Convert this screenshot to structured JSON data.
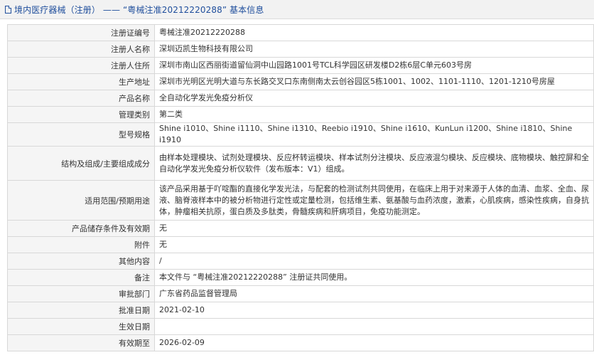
{
  "header": {
    "icon": "document-icon",
    "title": "境内医疗器械（注册） —— “粤械注准20212220288” 基本信息"
  },
  "rows": [
    {
      "label": "注册证编号",
      "value": "粤械注准20212220288"
    },
    {
      "label": "注册人名称",
      "value": "深圳迈凯生物科技有限公司"
    },
    {
      "label": "注册人住所",
      "value": "深圳市南山区西丽街道留仙洞中山园路1001号TCL科学园区研发楼D2栋6层C单元603号房"
    },
    {
      "label": "生产地址",
      "value": "深圳市光明区光明大道与东长路交叉口东南侧南太云创谷园区5栋1001、1002、1101-1110、1201-1210号房屋"
    },
    {
      "label": "产品名称",
      "value": "全自动化学发光免疫分析仪"
    },
    {
      "label": "管理类别",
      "value": "第二类"
    },
    {
      "label": "型号规格",
      "value": "Shine i1010、Shine i1110、Shine i1310、Reebio i1910、Shine i1610、KunLun i1200、Shine i1810、Shine i1910"
    },
    {
      "label": "结构及组成/主要组成成分",
      "value": "由样本处理模块、试剂处理模块、反应杯转运模块、样本试剂分注模块、反应液混匀模块、反应模块、底物模块、触控屏和全自动化学发光免疫分析仪软件（发布版本：V1）组成。"
    },
    {
      "label": "适用范围/预期用途",
      "value": "该产品采用基于吖啶酯的直接化学发光法，与配套的检测试剂共同使用，在临床上用于对来源于人体的血清、血浆、全血、尿液、脑脊液样本中的被分析物进行定性或定量检测，包括维生素、氨基酸与血药浓度，激素，心肌疾病，感染性疾病，自身抗体，肿瘤相关抗原，蛋白质及多肽类，骨髓疾病和肝病项目，免疫功能测定。"
    },
    {
      "label": "产品储存条件及有效期",
      "value": "无"
    },
    {
      "label": "附件",
      "value": "无"
    },
    {
      "label": "其他内容",
      "value": "/"
    },
    {
      "label": "备注",
      "value": "本文件与 “粤械注准20212220288” 注册证共同使用。"
    },
    {
      "label": "审批部门",
      "value": "广东省药品监督管理局"
    },
    {
      "label": "批准日期",
      "value": "2021-02-10"
    },
    {
      "label": "生效日期",
      "value": ""
    },
    {
      "label": "有效期至",
      "value": "2026-02-09"
    }
  ]
}
